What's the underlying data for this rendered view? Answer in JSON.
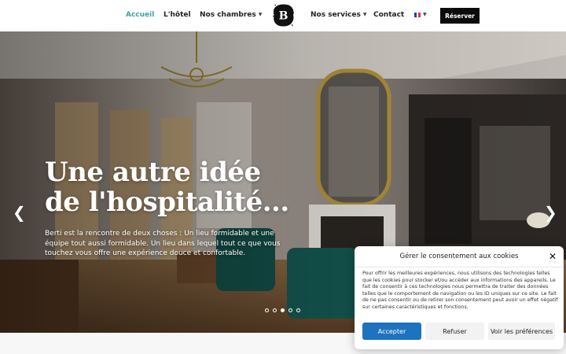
{
  "nav": {
    "items": [
      {
        "label": "Accueil",
        "active": true
      },
      {
        "label": "L'hôtel"
      },
      {
        "label": "Nos chambres",
        "dropdown": true
      },
      {
        "label": "Nos services",
        "dropdown": true
      },
      {
        "label": "Contact"
      }
    ],
    "logo_letter": "B",
    "language_icon": "french-flag-icon",
    "reserve_label": "Réserver",
    "active_color": "#3aa6a0"
  },
  "hero": {
    "title_line1": "Une autre idée",
    "title_line2": "de l'hospitalité...",
    "description": "Berti est la rencontre de deux choses : Un lieu formidable et une équipe tout aussi formidable. Un lieu dans lequel tout ce que vous touchez vous offre une expérience douce et confortable.",
    "prev_icon": "chevron-left-icon",
    "next_icon": "chevron-right-icon",
    "slides": 5,
    "active_slide": 3
  },
  "cookie": {
    "title": "Gérer le consentement aux cookies",
    "close_icon": "close-icon",
    "text": "Pour offrir les meilleures expériences, nous utilisons des technologies telles que les cookies pour stocker et/ou accéder aux informations des appareils. Le fait de consentir à ces technologies nous permettra de traiter des données telles que le comportement de navigation ou les ID uniques sur ce site. Le fait de ne pas consentir ou de retirer son consentement peut avoir un effet négatif sur certaines caractéristiques et fonctions.",
    "accept_label": "Accepter",
    "refuse_label": "Refuser",
    "prefs_label": "Voir les préférences",
    "accept_color": "#1e73be"
  }
}
